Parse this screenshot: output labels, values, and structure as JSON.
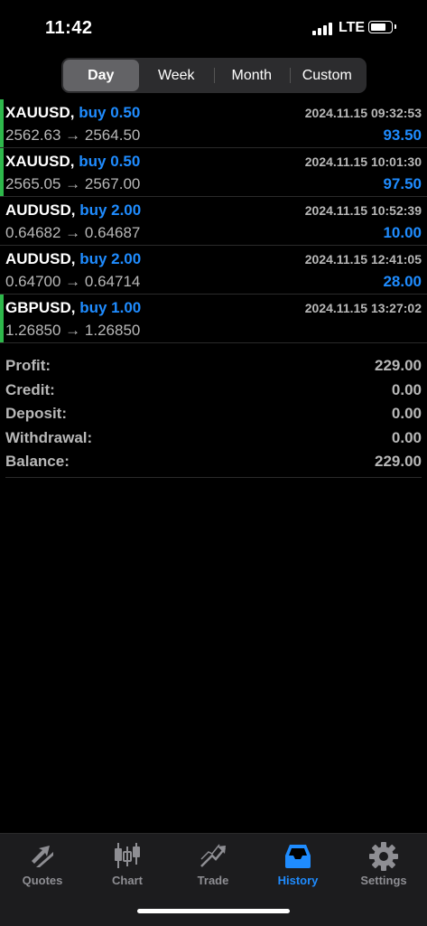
{
  "status_bar": {
    "time": "11:42",
    "network": "LTE"
  },
  "period_tabs": [
    {
      "label": "Day",
      "selected": true
    },
    {
      "label": "Week",
      "selected": false
    },
    {
      "label": "Month",
      "selected": false
    },
    {
      "label": "Custom",
      "selected": false
    }
  ],
  "deals": [
    {
      "symbol": "XAUUSD,",
      "side": "buy 0.50",
      "time": "2024.11.15 09:32:53",
      "prices": "2562.63 → 2564.50",
      "profit": "93.50"
    },
    {
      "symbol": "XAUUSD,",
      "side": "buy 0.50",
      "time": "2024.11.15 10:01:30",
      "prices": "2565.05 → 2567.00",
      "profit": "97.50"
    },
    {
      "symbol": "AUDUSD,",
      "side": "buy 2.00",
      "time": "2024.11.15 10:52:39",
      "prices": "0.64682 → 0.64687",
      "profit": "10.00"
    },
    {
      "symbol": "AUDUSD,",
      "side": "buy 2.00",
      "time": "2024.11.15 12:41:05",
      "prices": "0.64700 → 0.64714",
      "profit": "28.00"
    },
    {
      "symbol": "GBPUSD,",
      "side": "buy 1.00",
      "time": "2024.11.15 13:27:02",
      "prices": "1.26850 → 1.26850",
      "profit": ""
    }
  ],
  "summary": [
    {
      "label": "Profit:",
      "value": "229.00"
    },
    {
      "label": "Credit:",
      "value": "0.00"
    },
    {
      "label": "Deposit:",
      "value": "0.00"
    },
    {
      "label": "Withdrawal:",
      "value": "0.00"
    },
    {
      "label": "Balance:",
      "value": "229.00"
    }
  ],
  "tab_bar": [
    {
      "label": "Quotes",
      "icon": "quotes-icon",
      "active": false
    },
    {
      "label": "Chart",
      "icon": "candlestick-chart-icon",
      "active": false
    },
    {
      "label": "Trade",
      "icon": "trade-icon",
      "active": false
    },
    {
      "label": "History",
      "icon": "history-inbox-icon",
      "active": true
    },
    {
      "label": "Settings",
      "icon": "gear-icon",
      "active": false
    }
  ],
  "colors": {
    "accent": "#1f8cff",
    "buy_bar": "#2eb84b",
    "muted": "#b8b8b8",
    "tab_inactive": "#8e8e93"
  }
}
